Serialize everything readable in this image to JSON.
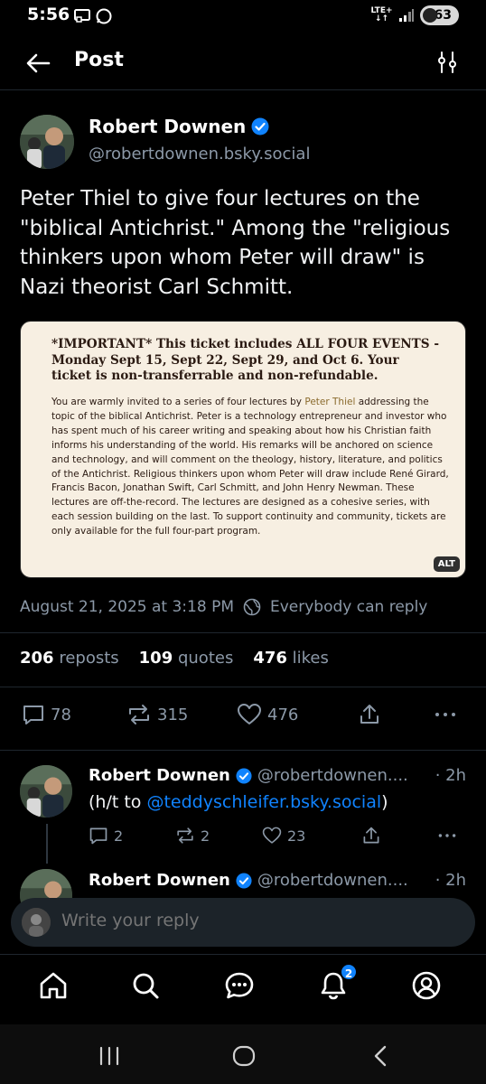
{
  "status_bar": {
    "time": "5:56",
    "network": "LTE+",
    "battery": "63"
  },
  "header": {
    "title": "Post"
  },
  "post": {
    "author_name": "Robert Downen",
    "author_handle": "@robertdownen.bsky.social",
    "text": "Peter Thiel to give four lectures on the \"biblical Antichrist.\" Among the \"religious thinkers upon whom Peter will draw\" is Nazi theorist Carl Schmitt.",
    "image": {
      "heading": "*IMPORTANT* This ticket includes ALL FOUR EVENTS - Monday Sept 15, Sept 22, Sept 29, and Oct 6. Your ticket is non-transferrable and non-refundable.",
      "body_pre": "You are warmly invited to a series of four lectures by ",
      "body_highlight": "Peter Thiel",
      "body_post": " addressing the topic of the biblical Antichrist. Peter is a technology entrepreneur and investor who has spent much of his career writing and speaking about how his Christian faith informs his understanding of the world. His remarks will be anchored on science and technology, and will comment on the theology, history, literature, and politics of the Antichrist. Religious thinkers upon whom Peter will draw include René Girard, Francis Bacon, Jonathan Swift, Carl Schmitt, and John Henry Newman. These lectures are off-the-record. The lectures are designed as a cohesive series, with each session building on the last. To support continuity and community, tickets are only available for the full four-part program.",
      "alt_label": "ALT"
    },
    "timestamp": "August 21, 2025 at 3:18 PM",
    "reply_setting": "Everybody can reply",
    "stats": {
      "reposts_count": "206",
      "reposts_label": "reposts",
      "quotes_count": "109",
      "quotes_label": "quotes",
      "likes_count": "476",
      "likes_label": "likes"
    },
    "actions": {
      "replies": "78",
      "reposts": "315",
      "likes": "476"
    }
  },
  "replies": [
    {
      "author_name": "Robert Downen",
      "author_handle": "@robertdownen....",
      "time": "· 2h",
      "text_pre": "(h/t to ",
      "text_link": "@teddyschleifer.bsky.social",
      "text_post": ")",
      "replies": "2",
      "reposts": "2",
      "likes": "23"
    },
    {
      "author_name": "Robert Downen",
      "author_handle": "@robertdownen....",
      "time": "· 2h"
    }
  ],
  "composer": {
    "placeholder": "Write your reply"
  },
  "bottom_nav": {
    "notifications_badge": "2"
  },
  "colors": {
    "accent": "#1083fe",
    "muted": "#8c99a8",
    "background": "#000000",
    "card_bg": "#f7efe2"
  }
}
